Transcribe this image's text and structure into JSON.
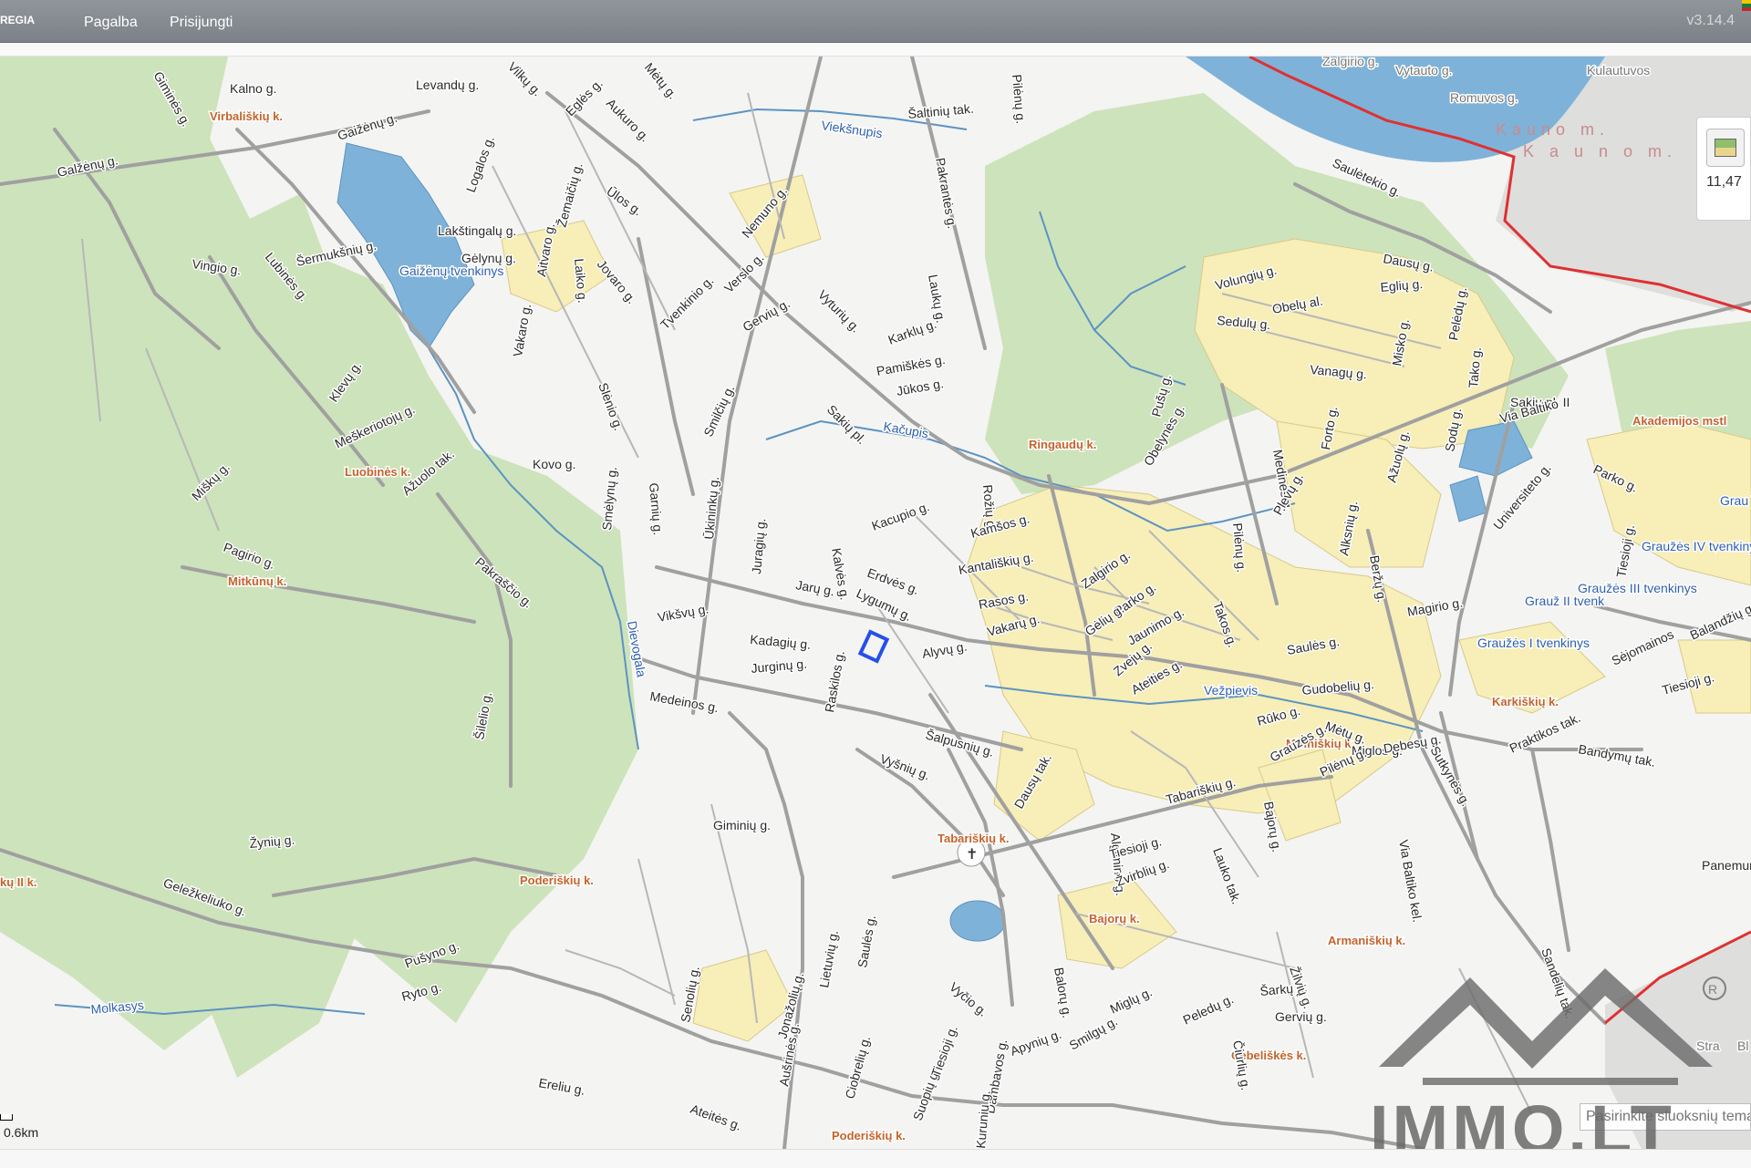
{
  "app": {
    "brand": "REGIA",
    "version": "v3.14.4"
  },
  "topbar": {
    "nav": [
      "Pagalba",
      "Prisijungti"
    ]
  },
  "map": {
    "streets": [
      "Giminės g.",
      "Kalno g.",
      "Levandų g.",
      "Vilkų g.",
      "Eglės g.",
      "Aukuro g.",
      "Mėtų g.",
      "Gaižėnų g.",
      "Galžėnų g.",
      "Lakštingalų g.",
      "Logalos g.",
      "Žemaičių g.",
      "Ūlos g.",
      "Gėlynų g.",
      "Aitvaro g.",
      "Laiko g.",
      "Jovaro g.",
      "Šermukšnių g.",
      "Vingio g.",
      "Lubinės g.",
      "Nemuno g.",
      "Verslo g.",
      "Tvenkinio g.",
      "Vyturių g.",
      "Sakių pl.",
      "Karklų g.",
      "Pamiškės g.",
      "Jūkos g.",
      "Laukų g.",
      "Klevų g.",
      "Miškų g.",
      "Meškeriotojų g.",
      "Vakaro g.",
      "Slėnio g.",
      "Gervių g.",
      "Smilčių g.",
      "Kovo g.",
      "Smėlynų g.",
      "Garnių g.",
      "Ūkininkų g.",
      "Ažuolo tak.",
      "Pagirio g.",
      "Pakraščio g.",
      "Juragių g.",
      "Kalvės g.",
      "Kacupio g.",
      "Rožių g.",
      "Kamšos g.",
      "Erdvės g.",
      "Kantališkių g.",
      "Lygumų g.",
      "Jarų g.",
      "Rasos g.",
      "Vikšvų g.",
      "Kadagių g.",
      "Jurginų g.",
      "Alyvų g.",
      "Vakarų g.",
      "Medeinos g.",
      "Raskilos g.",
      "Šalpusnių g.",
      "Vyšnių g.",
      "Šilelio g.",
      "Žynių g.",
      "Giminių g.",
      "Geležkeliuko g.",
      "Pušyno g.",
      "Ryto g.",
      "Senolių g.",
      "Jonažolių g.",
      "Aušrinės g.",
      "Lietuvių g.",
      "Saulės g.",
      "Ciobrelių g.",
      "Suopių g.",
      "Vyčio g.",
      "Tiesioji g.",
      "Dambavos g.",
      "Kuruniu g.",
      "Apynių g.",
      "Smilgų g.",
      "Balorų g.",
      "Miglų g.",
      "Peledų g.",
      "Čiurlių g.",
      "Šarkų g.",
      "Gervių g.",
      "Žilvių g.",
      "Ereliu g.",
      "Ateitės g.",
      "Zalgirio g.",
      "Parko g.",
      "Gėlių g.",
      "Jaunimo g.",
      "Zvejų g.",
      "Ateities g.",
      "Takos g.",
      "Saulės g.",
      "Gudobelių g.",
      "Rūko g.",
      "Mėtų g.",
      "Miglos g.",
      "Debesų g.",
      "Sutkynės g.",
      "Grauzės g.",
      "Dausų tak.",
      "Algimino g.",
      "Tabariškių g.",
      "Bajorų g.",
      "Lauko tak.",
      "Žvirblių g.",
      "Tiesioji g.",
      "Pilėnų g.",
      "Via Baltiko kel.",
      "Sandelių tak.",
      "Praktikos tak.",
      "Bandymų tak.",
      "Tiesioji g.",
      "Sėjomainos",
      "Panemunės g.",
      "Saulėtekio g.",
      "Dausų g.",
      "Eglių g.",
      "Volungių g.",
      "Obelų al.",
      "Pelėdų g.",
      "Sedulų g.",
      "Vanagų g.",
      "Misko g.",
      "Pušų g.",
      "Obelynės g.",
      "Medinės g.",
      "Forto g.",
      "Ažuolų g.",
      "Alksnių g.",
      "Beržų g.",
      "Magirio g.",
      "Plevų g.",
      "Pilėnų g.",
      "Sodų g.",
      "Tako g.",
      "Sakių pl. II",
      "Via Baltiko",
      "Universiteto g.",
      "Parko g.",
      "Tiesioji g.",
      "Balandžių g.",
      "Pakrantės g.",
      "Šaltinių tak.",
      "Pilėnų g."
    ],
    "water": [
      "Gaižėnų tvenkinys",
      "Viekšnupis",
      "Kačupis",
      "Dievogala",
      "Vežpievis",
      "Molkasys",
      "Grauž II tvenk",
      "Graužės III tvenkinys",
      "Graužės IV tvenkinys",
      "Graužės I tvenkinys",
      "Grau V tvenk"
    ],
    "villages": [
      "Virbališkių k.",
      "Luobinės k.",
      "Mitkūnų k.",
      "Ringaudų k.",
      "Poderiškių k.",
      "Tabariškių k.",
      "Bajorų k.",
      "Miriniškių k.",
      "Armaniškių k.",
      "Karkiškių k.",
      "Čebeliškės k.",
      "Akademijos mstl",
      "kų II k.",
      "Poderiškių k."
    ],
    "city": "K a u n o   m.",
    "city_small": "Kauno m.",
    "city_streets": [
      "Vytauto g.",
      "Romuvos g.",
      "Kulautuvos",
      "Žalgirio g.",
      "Stra",
      "Bl"
    ],
    "scale_label": "0.6km",
    "layer_widget_value": "11,47",
    "layer_input_placeholder": "Pasirinkite sluoksnių tema",
    "watermark": "IMMO.LT",
    "colors": {
      "forest": "#cde3bb",
      "water": "#7fb2d8",
      "road": "#a0a0a0",
      "boundary": "#e03030",
      "built": "#f7eeb8",
      "selected_parcel": "#2450e8"
    }
  }
}
